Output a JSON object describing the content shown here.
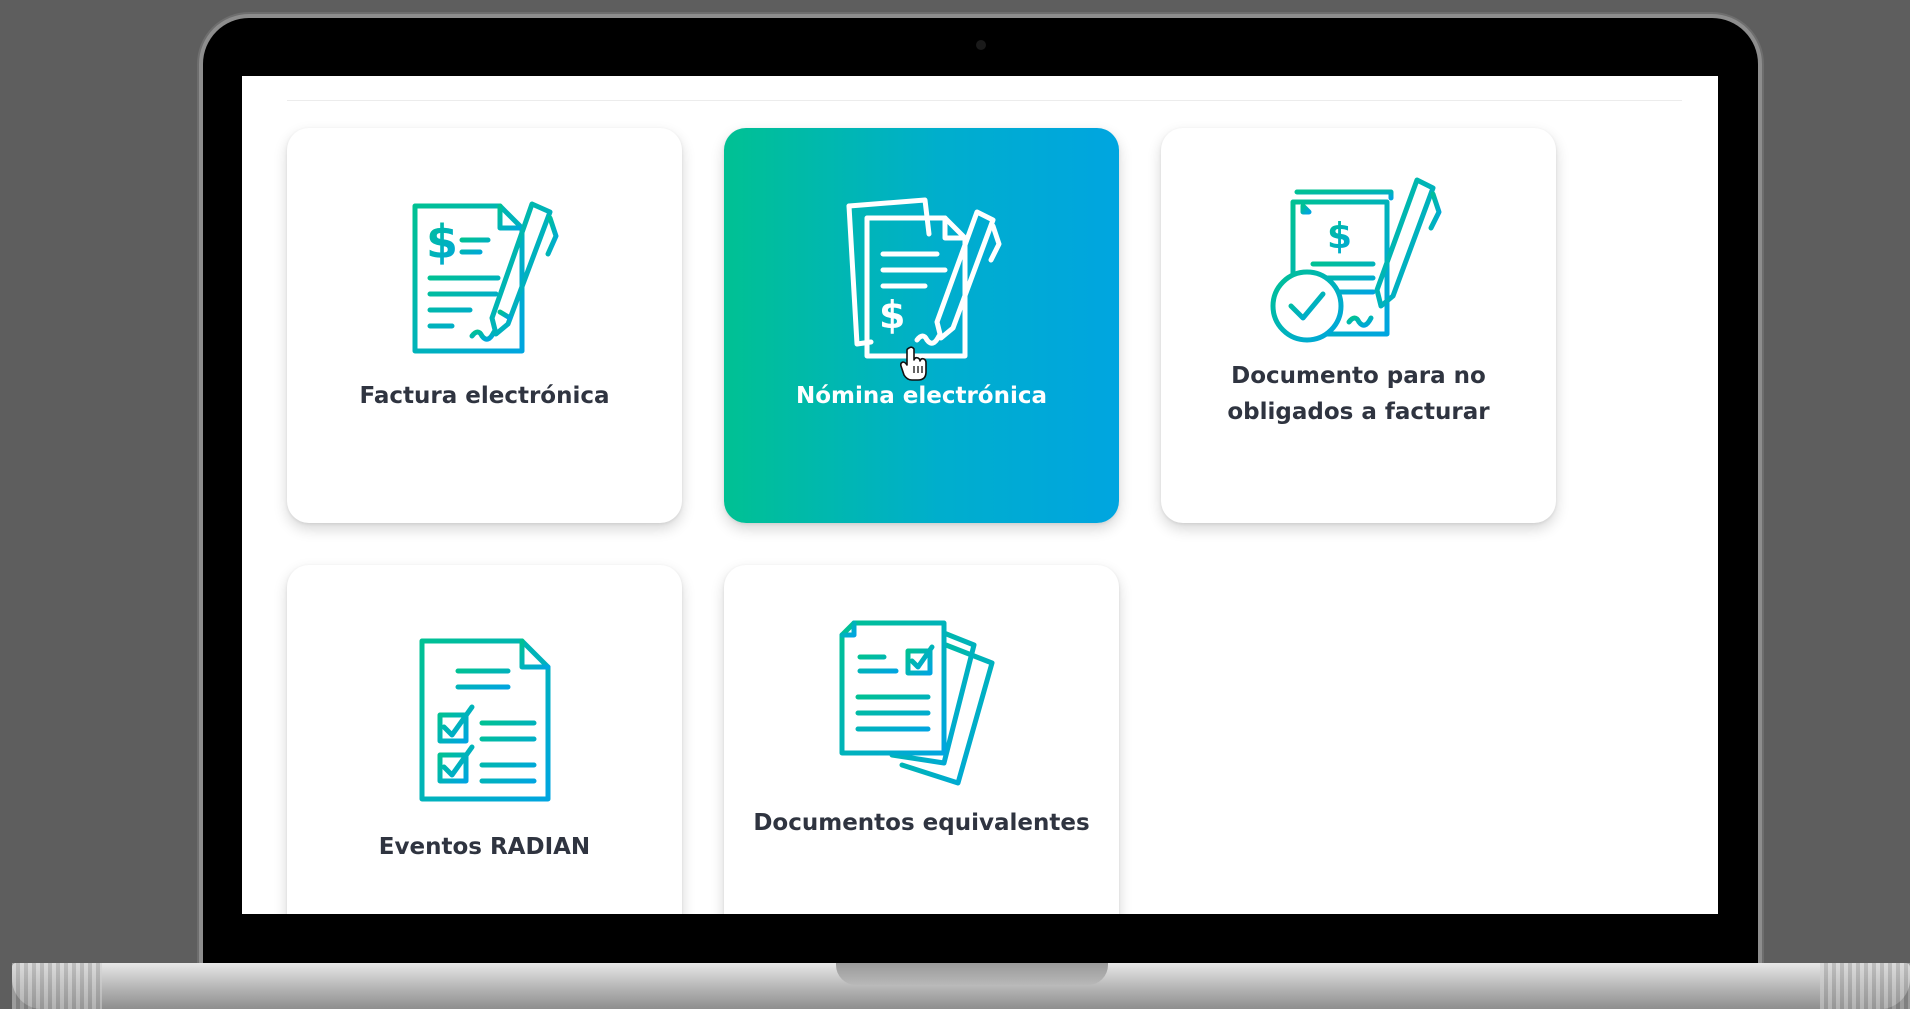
{
  "tiles": [
    {
      "label": "Factura electrónica",
      "icon": "invoice-pen-icon",
      "active": false
    },
    {
      "label": "Nómina electrónica",
      "icon": "payroll-documents-pen-icon",
      "active": true
    },
    {
      "label": "Documento para no obligados a facturar",
      "icon": "document-check-pen-icon",
      "active": false
    },
    {
      "label": "Eventos RADIAN",
      "icon": "checklist-document-icon",
      "active": false
    },
    {
      "label": "Documentos equivalentes",
      "icon": "stacked-documents-icon",
      "active": false
    }
  ],
  "colors": {
    "gradient_start": "#00c193",
    "gradient_end": "#00a5e0",
    "label_text": "#2f3440",
    "background": "#5e5e5e"
  },
  "cursor": "hand-pointer-icon"
}
